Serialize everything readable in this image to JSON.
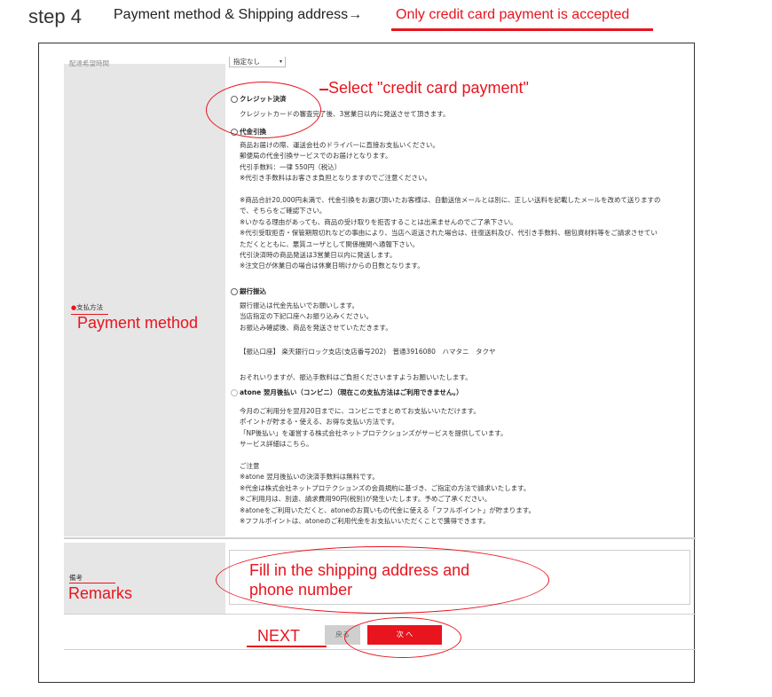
{
  "header": {
    "step": "step 4",
    "title": "Payment method & Shipping address→",
    "note": "Only credit card payment is accepted"
  },
  "delivery_time": {
    "label": "配達希望時間",
    "select_value": "指定なし"
  },
  "payment": {
    "label_jp": "支払方法",
    "label_en": "Payment method",
    "credit": {
      "title": "クレジット決済",
      "desc": "クレジットカードの審査完了後、3営業日以内に発送させて頂きます。"
    },
    "cod": {
      "title": "代金引換",
      "lines": [
        "商品お届けの際、運送会社のドライバーに直接お支払いください。",
        "郵便局の代金引換サービスでのお届けとなります。",
        "代引手数料：一律 550円（税込）",
        "※代引き手数料はお客さま負担となりますのでご注意ください。",
        "",
        "※商品合計20,000円未満で、代金引換をお選び頂いたお客様は、自動送信メールとは別に、正しい送料を記載したメールを改めて送りますの",
        "で、そちらをご確認下さい。",
        "※いかなる理由があっても、商品の受け取りを拒否することは出来ませんのでご了承下さい。",
        "※代引受取拒否・保管期限切れなどの事由により、当店へ返送された場合は、往復送料及び、代引き手数料、梱包資材料等をご請求させてい",
        "ただくとともに、悪質ユーザとして関係機関へ通報下さい。",
        "代引決済時の商品発送は3営業日以内に発送します。",
        "※注文日が休業日の場合は休業日明けからの日数となります。"
      ]
    },
    "bank": {
      "title": "銀行振込",
      "lines": [
        "銀行振込は代金先払いでお願いします。",
        "当店指定の下記口座へお振り込みください。",
        "お振込み確認後、商品を発送させていただきます。"
      ],
      "account": "【振込口座】 楽天銀行ロック支店(支店番号202)　普通3916080　ハマタニ　タクヤ",
      "fee_note": "おそれいりますが、振込手数料はご負担くださいますようお願いいたします。"
    },
    "atone": {
      "title": "atone 翌月後払い（コンビニ）（現在この支払方法はご利用できません。）",
      "lines": [
        "今月のご利用分を翌月20日までに、コンビニでまとめてお支払いいただけます。",
        "ポイントが貯まる・使える、お得な支払い方法です。",
        "「NP後払い」を運営する株式会社ネットプロテクションズがサービスを提供しています。",
        "サービス詳細はこちら。",
        "",
        "ご注意",
        "※atone 翌月後払いの決済手数料は無料です。",
        "※代金は株式会社ネットプロテクションズの会員規約に基づき、ご指定の方法で請求いたします。",
        "※ご利用月は、別途、請求費用90円(税別)が発生いたします。予めご了承ください。",
        "※atoneをご利用いただくと、atoneのお買いもの代金に使える「フフルポイント」が貯まります。",
        "※フフルポイントは、atoneのご利用代金をお支払いいただくことで獲得できます。"
      ]
    }
  },
  "remarks": {
    "label_jp": "備考",
    "label_en": "Remarks",
    "annotation": [
      "Fill in the shipping address and",
      "phone number"
    ]
  },
  "annotations": {
    "select_credit": "Select \"credit card payment\"",
    "next": "NEXT"
  },
  "buttons": {
    "back": "戻る",
    "next": "次 へ"
  },
  "colors": {
    "accent": "#e8141e",
    "label_bg": "#e6e6e6"
  }
}
